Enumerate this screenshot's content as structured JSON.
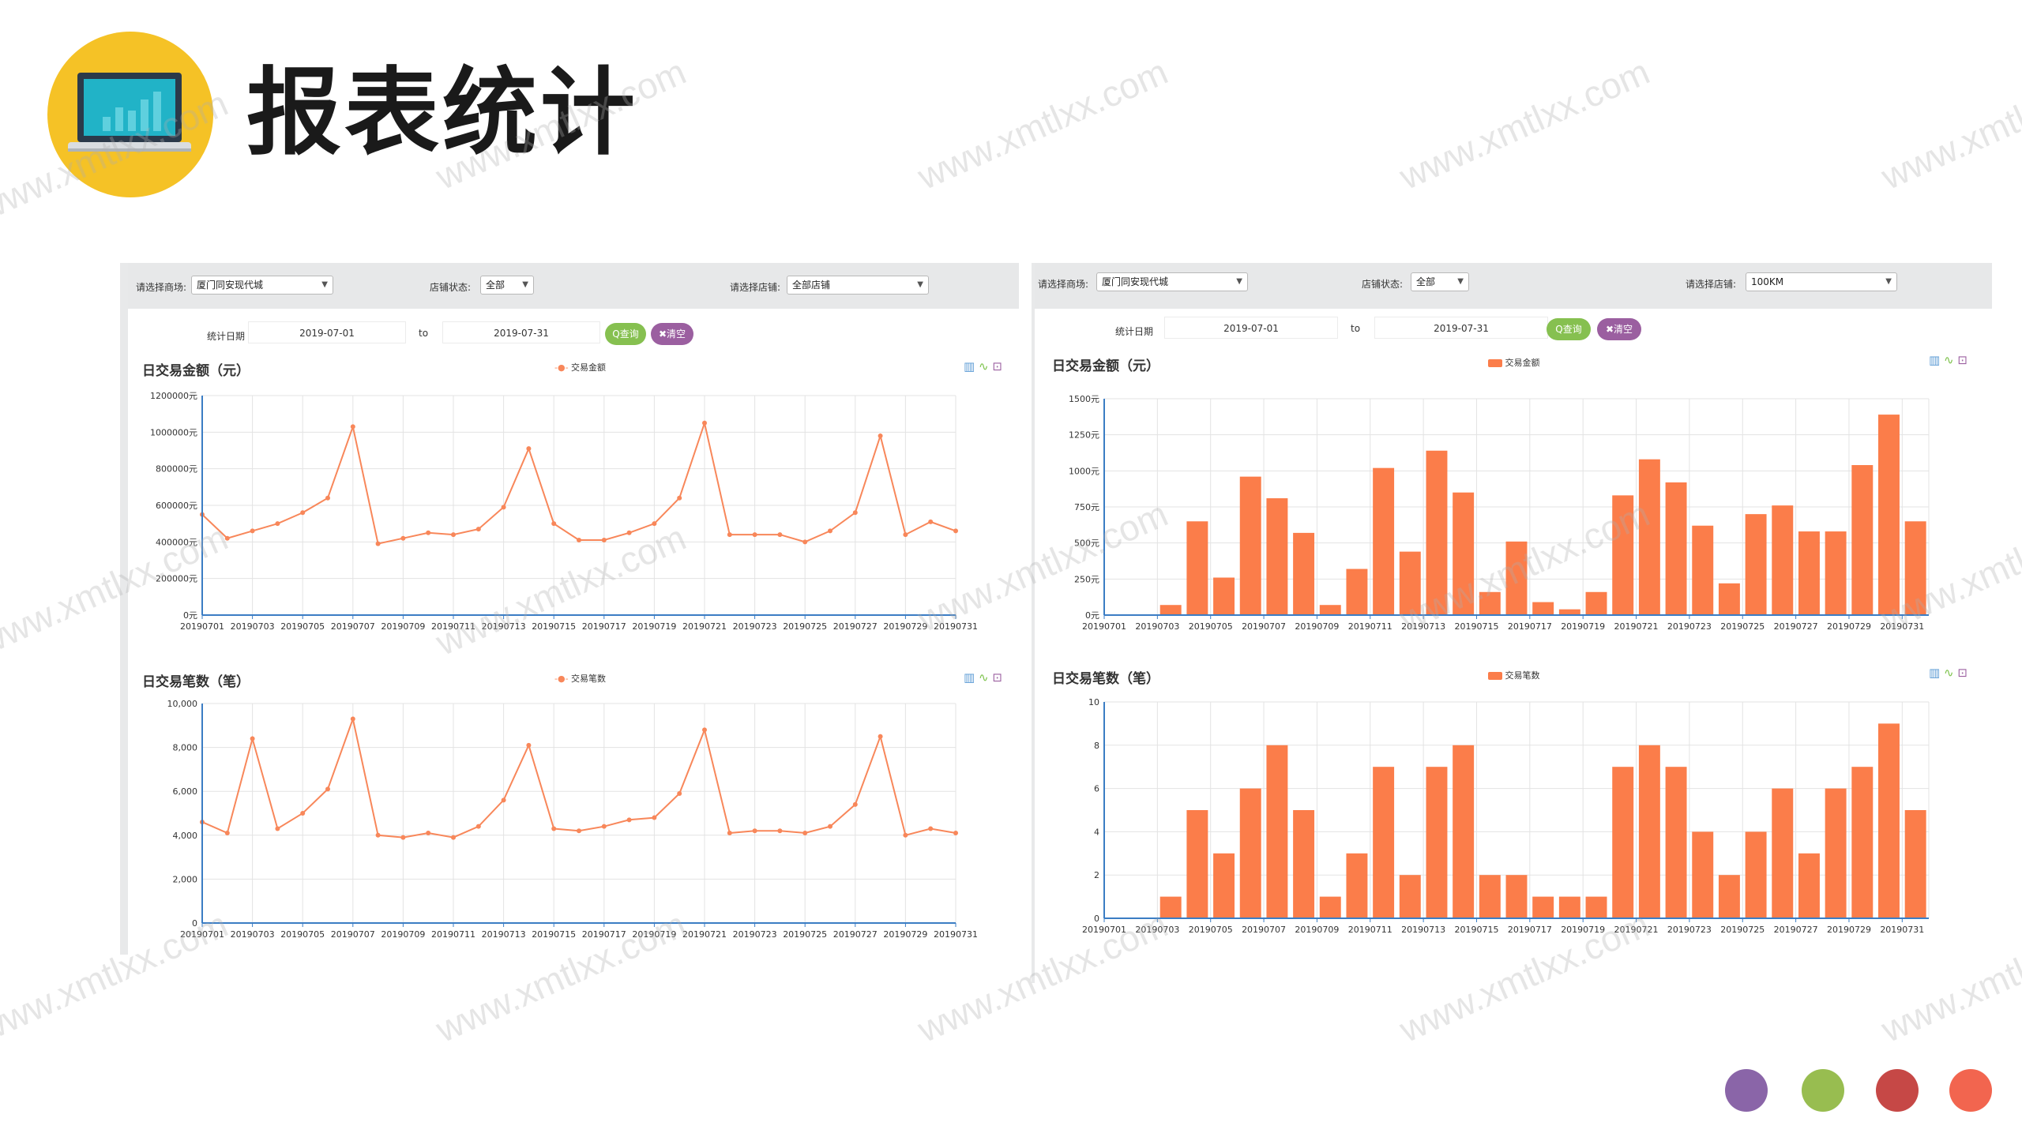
{
  "header": {
    "title": "报表统计",
    "logo_icon": "laptop-chart-icon"
  },
  "watermark": "www.xmtlxx.com",
  "colors": {
    "accent": "#fa7d4a",
    "line": "#f8875a",
    "bar": "#fb7d4a",
    "axis": "#3b7dc4",
    "query_button": "#86c050",
    "clear_button": "#9b5fa0"
  },
  "left_panel": {
    "filters": {
      "mall_label": "请选择商场:",
      "mall_value": "厦门同安现代城",
      "status_label": "店铺状态:",
      "status_value": "全部",
      "store_label": "请选择店铺:",
      "store_value": "全部店铺"
    },
    "date_range": {
      "label": "统计日期",
      "start": "2019-07-01",
      "to": "to",
      "end": "2019-07-31",
      "query_button": "Q查询",
      "clear_button": "✖清空"
    },
    "chart1": {
      "title": "日交易金额（元）",
      "legend": "交易金额"
    },
    "chart2": {
      "title": "日交易笔数（笔）",
      "legend": "交易笔数"
    }
  },
  "right_panel": {
    "filters": {
      "mall_label": "请选择商场:",
      "mall_value": "厦门同安现代城",
      "status_label": "店铺状态:",
      "status_value": "全部",
      "store_label": "请选择店铺:",
      "store_value": "100KM"
    },
    "date_range": {
      "label": "统计日期",
      "start": "2019-07-01",
      "to": "to",
      "end": "2019-07-31",
      "query_button": "Q查询",
      "clear_button": "✖清空"
    },
    "chart1": {
      "title": "日交易金额（元）",
      "legend": "交易金额"
    },
    "chart2": {
      "title": "日交易笔数（笔）",
      "legend": "交易笔数"
    }
  },
  "chart_data": [
    {
      "type": "line",
      "title": "日交易金额（元）",
      "series_name": "交易金额",
      "x": [
        "20190701",
        "20190702",
        "20190703",
        "20190704",
        "20190705",
        "20190706",
        "20190707",
        "20190708",
        "20190709",
        "20190710",
        "20190711",
        "20190712",
        "20190713",
        "20190714",
        "20190715",
        "20190716",
        "20190717",
        "20190718",
        "20190719",
        "20190720",
        "20190721",
        "20190722",
        "20190723",
        "20190724",
        "20190725",
        "20190726",
        "20190727",
        "20190728",
        "20190729",
        "20190730",
        "20190731"
      ],
      "values": [
        550000,
        420000,
        460000,
        500000,
        560000,
        640000,
        1030000,
        390000,
        420000,
        450000,
        440000,
        470000,
        590000,
        910000,
        500000,
        410000,
        410000,
        450000,
        500000,
        640000,
        1050000,
        440000,
        440000,
        440000,
        400000,
        460000,
        560000,
        980000,
        440000,
        510000,
        460000
      ],
      "yticks": [
        0,
        200000,
        400000,
        600000,
        800000,
        1000000,
        1200000
      ],
      "ytick_labels": [
        "0元",
        "200000元",
        "400000元",
        "600000元",
        "800000元",
        "1000000元",
        "1200000元"
      ],
      "ylim": [
        0,
        1200000
      ],
      "xtick_labels": [
        "20190701",
        "20190703",
        "20190705",
        "20190707",
        "20190709",
        "20190711",
        "20190713",
        "20190715",
        "20190717",
        "20190719",
        "20190721",
        "20190723",
        "20190725",
        "20190727",
        "20190729",
        "20190731"
      ]
    },
    {
      "type": "line",
      "title": "日交易笔数（笔）",
      "series_name": "交易笔数",
      "x": [
        "20190701",
        "20190702",
        "20190703",
        "20190704",
        "20190705",
        "20190706",
        "20190707",
        "20190708",
        "20190709",
        "20190710",
        "20190711",
        "20190712",
        "20190713",
        "20190714",
        "20190715",
        "20190716",
        "20190717",
        "20190718",
        "20190719",
        "20190720",
        "20190721",
        "20190722",
        "20190723",
        "20190724",
        "20190725",
        "20190726",
        "20190727",
        "20190728",
        "20190729",
        "20190730",
        "20190731"
      ],
      "values": [
        4600,
        4100,
        8400,
        4300,
        5000,
        6100,
        9300,
        4000,
        3900,
        4100,
        3900,
        4400,
        5600,
        8100,
        4300,
        4200,
        4400,
        4700,
        4800,
        5900,
        8800,
        4100,
        4200,
        4200,
        4100,
        4400,
        5400,
        8500,
        4000,
        4300,
        4100
      ],
      "yticks": [
        0,
        2000,
        4000,
        6000,
        8000,
        10000
      ],
      "ytick_labels": [
        "0",
        "2,000",
        "4,000",
        "6,000",
        "8,000",
        "10,000"
      ],
      "ylim": [
        0,
        10000
      ],
      "xtick_labels": [
        "20190701",
        "20190703",
        "20190705",
        "20190707",
        "20190709",
        "20190711",
        "20190713",
        "20190715",
        "20190717",
        "20190719",
        "20190721",
        "20190723",
        "20190725",
        "20190727",
        "20190729",
        "20190731"
      ]
    },
    {
      "type": "bar",
      "title": "日交易金额（元）",
      "series_name": "交易金额",
      "x": [
        "20190701",
        "20190702",
        "20190703",
        "20190704",
        "20190705",
        "20190706",
        "20190707",
        "20190708",
        "20190709",
        "20190710",
        "20190711",
        "20190712",
        "20190713",
        "20190714",
        "20190715",
        "20190716",
        "20190717",
        "20190718",
        "20190719",
        "20190720",
        "20190721",
        "20190722",
        "20190723",
        "20190724",
        "20190725",
        "20190726",
        "20190727",
        "20190728",
        "20190729",
        "20190730",
        "20190731"
      ],
      "values": [
        0,
        0,
        70,
        650,
        260,
        960,
        810,
        570,
        70,
        320,
        1020,
        440,
        1140,
        850,
        160,
        510,
        90,
        40,
        160,
        830,
        1080,
        920,
        620,
        220,
        700,
        760,
        580,
        580,
        1040,
        1390,
        650
      ],
      "yticks": [
        0,
        250,
        500,
        750,
        1000,
        1250,
        1500
      ],
      "ytick_labels": [
        "0元",
        "250元",
        "500元",
        "750元",
        "1000元",
        "1250元",
        "1500元"
      ],
      "ylim": [
        0,
        1500
      ],
      "xtick_labels": [
        "20190701",
        "20190703",
        "20190705",
        "20190707",
        "20190709",
        "20190711",
        "20190713",
        "20190715",
        "20190717",
        "20190719",
        "20190721",
        "20190723",
        "20190725",
        "20190727",
        "20190729",
        "20190731"
      ]
    },
    {
      "type": "bar",
      "title": "日交易笔数（笔）",
      "series_name": "交易笔数",
      "x": [
        "20190701",
        "20190702",
        "20190703",
        "20190704",
        "20190705",
        "20190706",
        "20190707",
        "20190708",
        "20190709",
        "20190710",
        "20190711",
        "20190712",
        "20190713",
        "20190714",
        "20190715",
        "20190716",
        "20190717",
        "20190718",
        "20190719",
        "20190720",
        "20190721",
        "20190722",
        "20190723",
        "20190724",
        "20190725",
        "20190726",
        "20190727",
        "20190728",
        "20190729",
        "20190730",
        "20190731"
      ],
      "values": [
        0,
        0,
        1,
        5,
        3,
        6,
        8,
        5,
        1,
        3,
        7,
        2,
        7,
        8,
        2,
        2,
        1,
        1,
        1,
        7,
        8,
        7,
        4,
        2,
        4,
        6,
        3,
        6,
        7,
        9,
        5
      ],
      "yticks": [
        0,
        2,
        4,
        6,
        8,
        10
      ],
      "ytick_labels": [
        "0",
        "2",
        "4",
        "6",
        "8",
        "10"
      ],
      "ylim": [
        0,
        10
      ],
      "xtick_labels": [
        "20190701",
        "20190703",
        "20190705",
        "20190707",
        "20190709",
        "20190711",
        "20190713",
        "20190715",
        "20190717",
        "20190719",
        "20190721",
        "20190723",
        "20190725",
        "20190727",
        "20190729",
        "20190731"
      ]
    }
  ]
}
